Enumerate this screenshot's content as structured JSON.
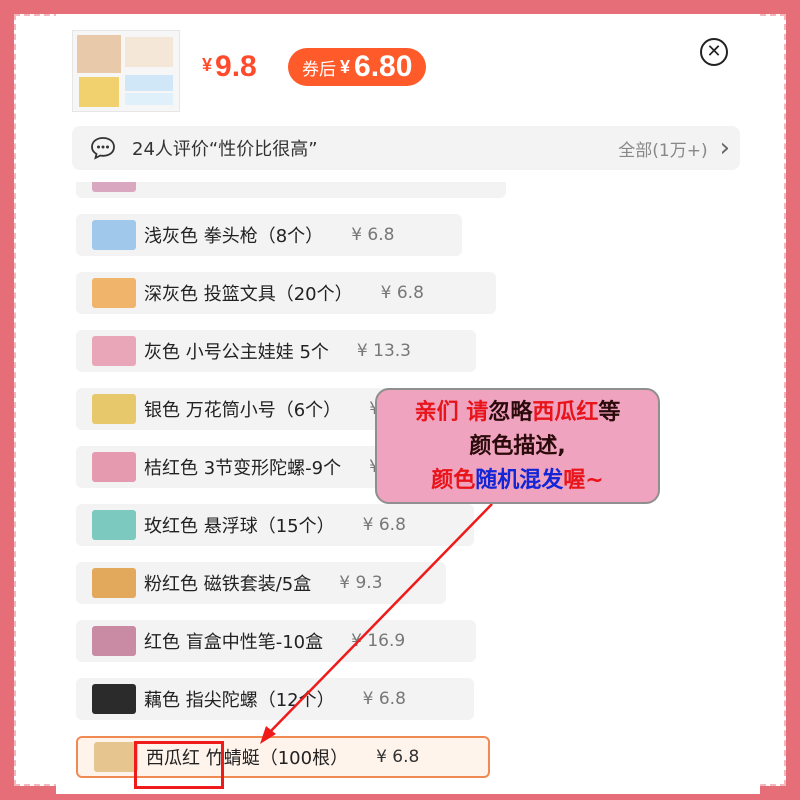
{
  "product": {
    "price_symbol": "¥",
    "price": "9.8",
    "coupon_label": "券后",
    "coupon_symbol": "¥",
    "coupon_price": "6.80"
  },
  "review_bar": {
    "text": "24人评价“性价比很高”",
    "all_label": "全部(1万+)"
  },
  "list_items": [
    {
      "name": "浅灰色 拳头枪（8个）",
      "price": "¥ 6.8",
      "icon": "water-gun-icon",
      "color": "#9fc8ea"
    },
    {
      "name": "深灰色 投篮文具（20个）",
      "price": "¥ 6.8",
      "icon": "basketball-stationery-icon",
      "color": "#f0b46a"
    },
    {
      "name": "灰色 小号公主娃娃 5个",
      "price": "¥ 13.3",
      "icon": "doll-icon",
      "color": "#e8a6b8"
    },
    {
      "name": "银色 万花筒小号（6个）",
      "price": "¥ 6.8",
      "icon": "kaleidoscope-icon",
      "color": "#e7c86a"
    },
    {
      "name": "桔红色 3节变形陀螺-9个",
      "price": "¥ 6.8",
      "icon": "spinning-top-icon",
      "color": "#e59ab0"
    },
    {
      "name": "玫红色 悬浮球（15个）",
      "price": "¥ 6.8",
      "icon": "floating-ball-icon",
      "color": "#7cc9c0"
    },
    {
      "name": "粉红色 磁铁套装/5盒",
      "price": "¥ 9.3",
      "icon": "magnet-set-icon",
      "color": "#e2a85c"
    },
    {
      "name": "红色 盲盒中性笔-10盒",
      "price": "¥ 16.9",
      "icon": "gel-pen-icon",
      "color": "#c98aa4"
    },
    {
      "name": "藕色 指尖陀螺（12个）",
      "price": "¥ 6.8",
      "icon": "fidget-spinner-icon",
      "color": "#2b2b2b"
    },
    {
      "name": "西瓜红 竹蜻蜓（100根）",
      "price": "¥ 6.8",
      "icon": "bamboo-dragonfly-icon",
      "color": "#e6c58f"
    }
  ],
  "notice": {
    "line1_a": "亲们",
    "line1_b": " 请",
    "line1_c": "忽略",
    "line1_d": "西瓜红",
    "line1_e": "等",
    "line2": "颜色描述,",
    "line3_a": "颜色",
    "line3_b": "随机混发",
    "line3_c": "喔~"
  },
  "colors": {
    "background": "#e56e78",
    "price_red": "#ff4b2b",
    "selected_border": "#f08a53",
    "notice_bg": "#f0a3bf",
    "highlight_box": "#ef1b1b"
  }
}
